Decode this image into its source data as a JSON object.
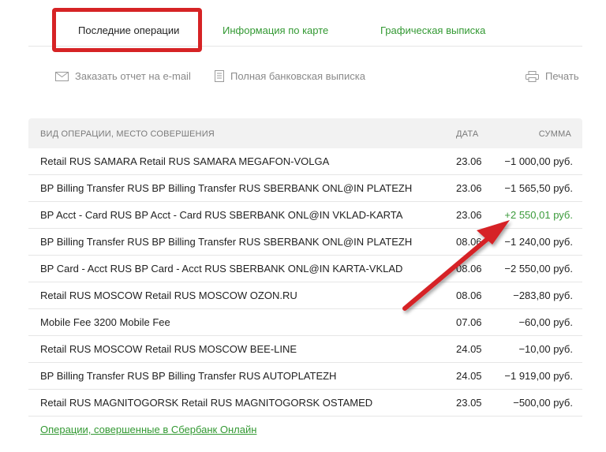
{
  "tabs": [
    {
      "label": "Последние операции",
      "active": true
    },
    {
      "label": "Информация по карте",
      "active": false
    },
    {
      "label": "Графическая выписка",
      "active": false
    }
  ],
  "actions": {
    "email_report": "Заказать отчет на e-mail",
    "full_statement": "Полная банковская выписка",
    "print": "Печать"
  },
  "table": {
    "headers": {
      "operation": "ВИД ОПЕРАЦИИ, МЕСТО СОВЕРШЕНИЯ",
      "date": "ДАТА",
      "amount": "СУММА"
    },
    "rows": [
      {
        "operation": "Retail RUS SAMARA Retail RUS SAMARA MEGAFON-VOLGA",
        "date": "23.06",
        "amount": "−1 000,00 руб."
      },
      {
        "operation": "BP Billing Transfer RUS BP Billing Transfer RUS SBERBANK ONL@IN PLATEZH",
        "date": "23.06",
        "amount": "−1 565,50 руб."
      },
      {
        "operation": "BP Acct - Card RUS BP Acct - Card RUS SBERBANK ONL@IN VKLAD-KARTA",
        "date": "23.06",
        "amount": "+2 550,01 руб."
      },
      {
        "operation": "BP Billing Transfer RUS BP Billing Transfer RUS SBERBANK ONL@IN PLATEZH",
        "date": "08.06",
        "amount": "−1 240,00 руб."
      },
      {
        "operation": "BP Card - Acct RUS BP Card - Acct RUS SBERBANK ONL@IN KARTA-VKLAD",
        "date": "08.06",
        "amount": "−2 550,00 руб."
      },
      {
        "operation": "Retail RUS MOSCOW Retail RUS MOSCOW OZON.RU",
        "date": "08.06",
        "amount": "−283,80 руб."
      },
      {
        "operation": "Mobile Fee 3200 Mobile Fee",
        "date": "07.06",
        "amount": "−60,00 руб."
      },
      {
        "operation": "Retail RUS MOSCOW Retail RUS MOSCOW BEE-LINE",
        "date": "24.05",
        "amount": "−10,00 руб."
      },
      {
        "operation": "BP Billing Transfer RUS BP Billing Transfer RUS AUTOPLATEZH",
        "date": "24.05",
        "amount": "−1 919,00 руб."
      },
      {
        "operation": "Retail RUS MAGNITOGORSK Retail RUS MAGNITOGORSK OSTAMED",
        "date": "23.05",
        "amount": "−500,00 руб."
      }
    ]
  },
  "footer": {
    "link": "Операции, совершенные в Сбербанк Онлайн"
  },
  "colors": {
    "accent_green": "#339933",
    "positive_amount": "#3a9a3a",
    "highlight_red": "#d62325"
  }
}
